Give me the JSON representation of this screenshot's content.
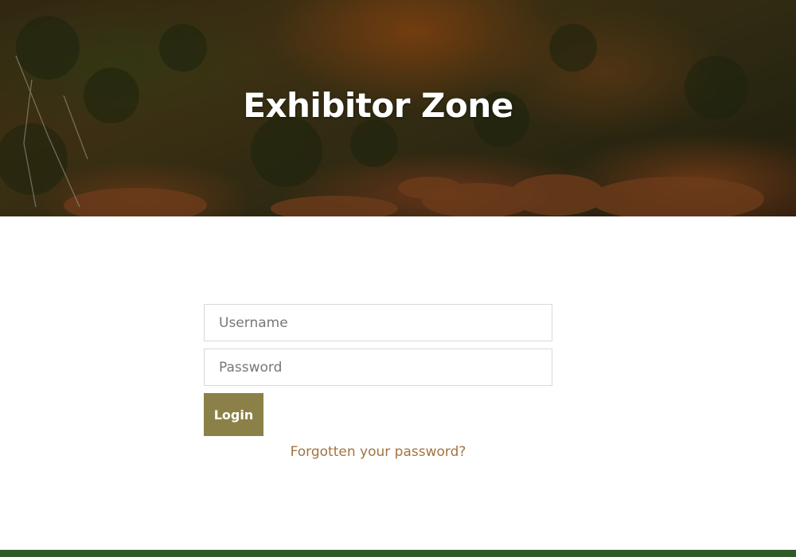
{
  "hero": {
    "title": "Exhibitor Zone"
  },
  "login_form": {
    "username_placeholder": "Username",
    "password_placeholder": "Password",
    "login_label": "Login",
    "forgot_link": "Forgotten your password?"
  },
  "colors": {
    "button": "#8b8148",
    "link": "#a4733f",
    "footer": "#2f5a26"
  }
}
